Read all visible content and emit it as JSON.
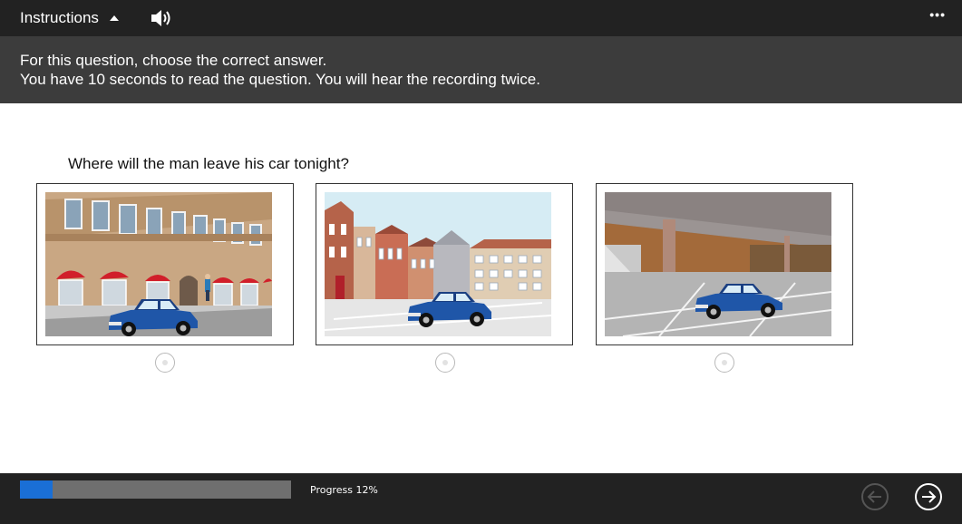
{
  "header": {
    "instructions_label": "Instructions",
    "speaker_icon": "speaker-icon",
    "more_label": "•••"
  },
  "instructions": {
    "line1": "For this question, choose the correct answer.",
    "line2": "You have 10 seconds to read the question. You will hear the recording twice."
  },
  "question": {
    "text": "Where will the man leave his car tonight?"
  },
  "options": [
    {
      "image": "car-on-street-illustration",
      "selected": false
    },
    {
      "image": "car-in-town-square-illustration",
      "selected": false
    },
    {
      "image": "car-in-parking-garage-illustration",
      "selected": false
    }
  ],
  "footer": {
    "progress_label": "Progress 12%",
    "progress_value": 0.12,
    "back_icon": "arrow-left-icon",
    "next_icon": "arrow-right-icon"
  },
  "colors": {
    "topbar": "#222222",
    "panel": "#3c3c3c",
    "progress_fill": "#1a6fd6",
    "progress_track": "#6f6f6f"
  }
}
